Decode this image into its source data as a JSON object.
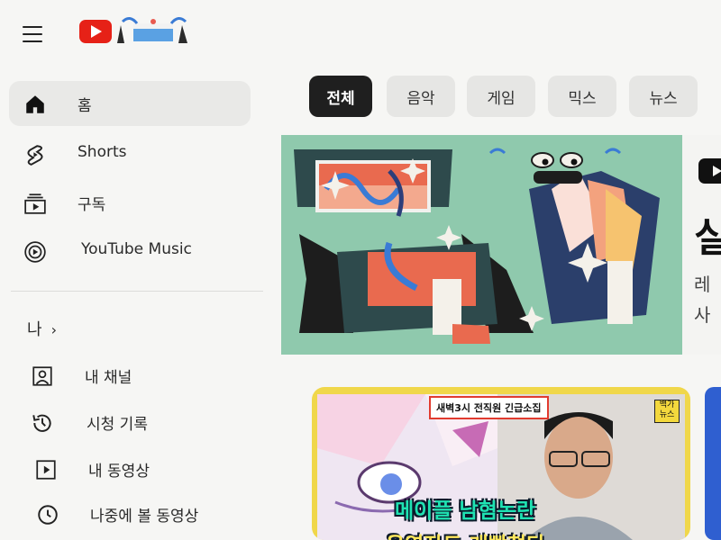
{
  "sidebar": {
    "items": [
      {
        "label": "홈",
        "icon": "home-icon"
      },
      {
        "label": "Shorts",
        "icon": "shorts-icon"
      },
      {
        "label": "구독",
        "icon": "subscriptions-icon"
      },
      {
        "label": "YouTube Music",
        "icon": "youtube-music-icon"
      }
    ],
    "you_section": {
      "label": "나",
      "chevron": "›",
      "items": [
        {
          "label": "내 채널",
          "icon": "person-icon"
        },
        {
          "label": "시청 기록",
          "icon": "history-icon"
        },
        {
          "label": "내 동영상",
          "icon": "play-square-icon"
        },
        {
          "label": "나중에 볼 동영상",
          "icon": "clock-icon"
        }
      ]
    }
  },
  "chips": [
    {
      "label": "전체",
      "active": true
    },
    {
      "label": "음악"
    },
    {
      "label": "게임"
    },
    {
      "label": "믹스"
    },
    {
      "label": "뉴스"
    }
  ],
  "banner": {
    "title_fragment": "실",
    "sub_1": "레",
    "sub_2": "사"
  },
  "video": {
    "tag": "새벽3시 전직원 긴급소집",
    "badge": "백가\n뉴스",
    "caption_line1": "메이플 남혐논란",
    "caption_line2": "운영자도 개빡쳤다"
  },
  "colors": {
    "youtube_red": "#e62117",
    "chip_active": "#1f1f1f",
    "banner_bg": "#8fc9ad",
    "card_border": "#f0d74a"
  }
}
